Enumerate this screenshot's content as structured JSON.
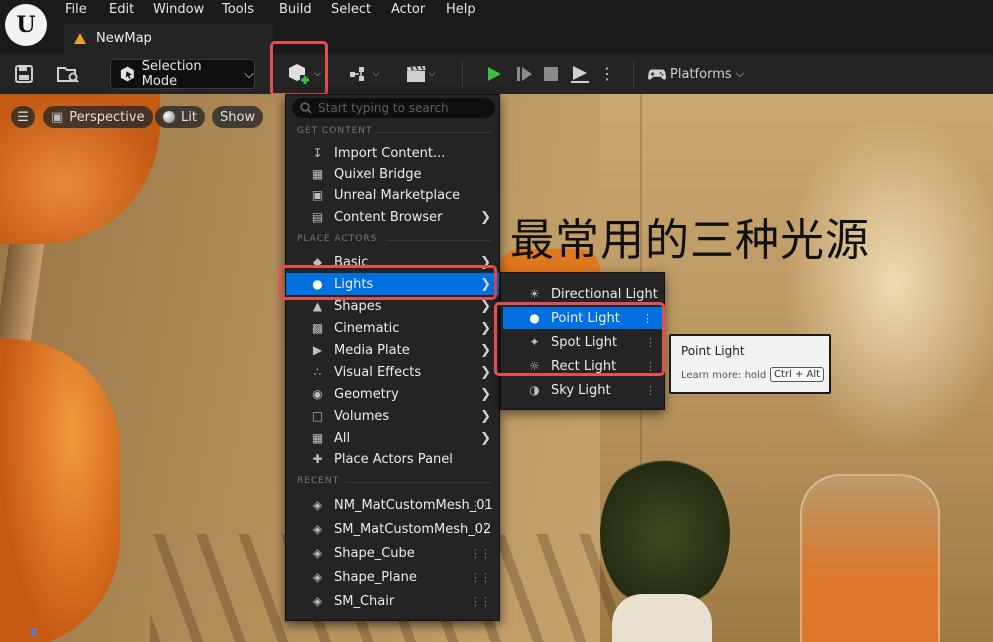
{
  "menubar": {
    "logo": "U",
    "items": [
      "File",
      "Edit",
      "Window",
      "Tools",
      "Build",
      "Select",
      "Actor",
      "Help"
    ]
  },
  "tab": {
    "label": "NewMap"
  },
  "toolbar": {
    "selection_mode": "Selection Mode",
    "platforms": "Platforms"
  },
  "viewport": {
    "view_mode": "Perspective",
    "lighting": "Lit",
    "show": "Show",
    "headline": "最常用的三种光源",
    "axis": "Z"
  },
  "dropdown": {
    "search_placeholder": "Start typing to search",
    "sections": {
      "get_content": "GET CONTENT",
      "place_actors": "PLACE ACTORS",
      "recent": "RECENT"
    },
    "get_content": [
      "Import Content...",
      "Quixel Bridge",
      "Unreal Marketplace",
      "Content Browser"
    ],
    "place_actors": [
      "Basic",
      "Lights",
      "Shapes",
      "Cinematic",
      "Media Plate",
      "Visual Effects",
      "Geometry",
      "Volumes",
      "All",
      "Place Actors Panel"
    ],
    "recent": [
      "NM_MatCustomMesh_01",
      "SM_MatCustomMesh_02",
      "Shape_Cube",
      "Shape_Plane",
      "SM_Chair"
    ]
  },
  "lights_submenu": [
    "Directional Light",
    "Point Light",
    "Spot Light",
    "Rect Light",
    "Sky Light"
  ],
  "tooltip": {
    "title": "Point Light",
    "learn_more": "Learn more: hold",
    "keys": "Ctrl + Alt"
  },
  "colors": {
    "accent": "#0070e0",
    "highlight_box": "#e05050",
    "play_green": "#3cbf3c"
  }
}
